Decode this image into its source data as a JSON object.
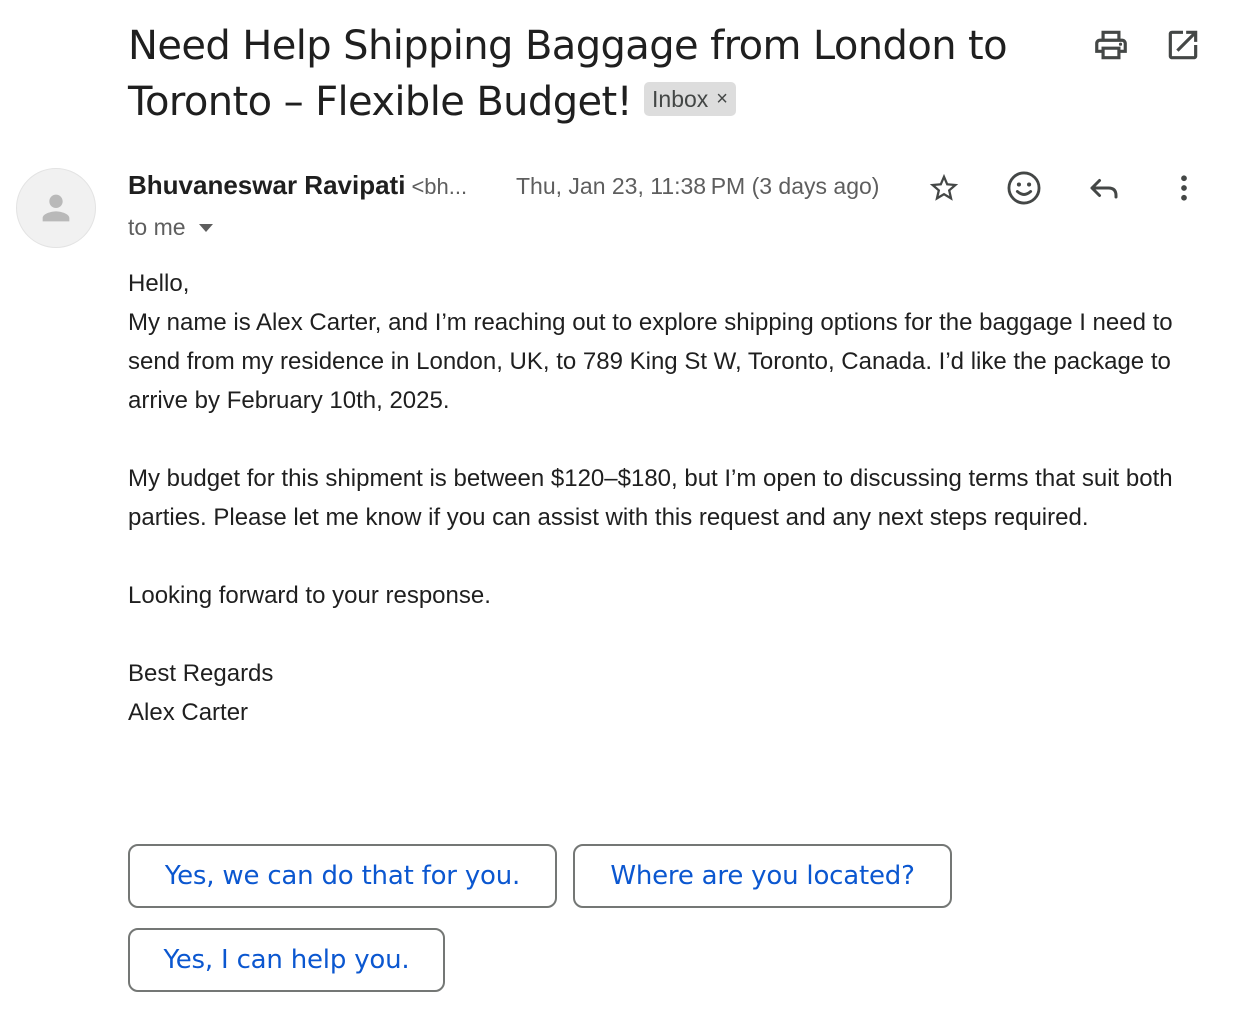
{
  "email": {
    "subject": "Need Help Shipping Baggage from London to Toronto – Flexible Budget!",
    "label": "Inbox",
    "label_remove": "×",
    "sender_name": "Bhuvaneswar Ravipati",
    "sender_email_truncated": "<bh...",
    "date": "Thu, Jan 23, 11:38 PM (3 days ago)",
    "recipient": "to me",
    "body": {
      "greeting": "Hello,",
      "paragraph1": "My name is Alex Carter, and I’m reaching out to explore shipping options for the baggage I need to send from my residence in London, UK, to 789 King St W, Toronto, Canada. I’d like the package to arrive by February 10th, 2025.",
      "paragraph2": "My budget for this shipment is between $120–$180, but I’m open to discussing terms that suit both parties. Please let me know if you can assist with this request and any next steps required.",
      "paragraph3": "Looking forward to your response.",
      "signoff": "Best Regards",
      "signature": "Alex Carter"
    }
  },
  "icons": {
    "print": "print-icon",
    "open_new_window": "open-in-new-icon",
    "star": "star-icon",
    "emoji": "emoji-icon",
    "reply": "reply-icon",
    "more": "more-vert-icon",
    "avatar": "person-icon",
    "dropdown": "arrow-drop-down-icon"
  },
  "smart_replies": [
    "Yes, we can do that for you.",
    "Where are you located?",
    "Yes, I can help you."
  ],
  "colors": {
    "link_blue": "#0b57d0",
    "chip_bg": "#dddddd",
    "text_secondary": "#5e5e5e"
  }
}
